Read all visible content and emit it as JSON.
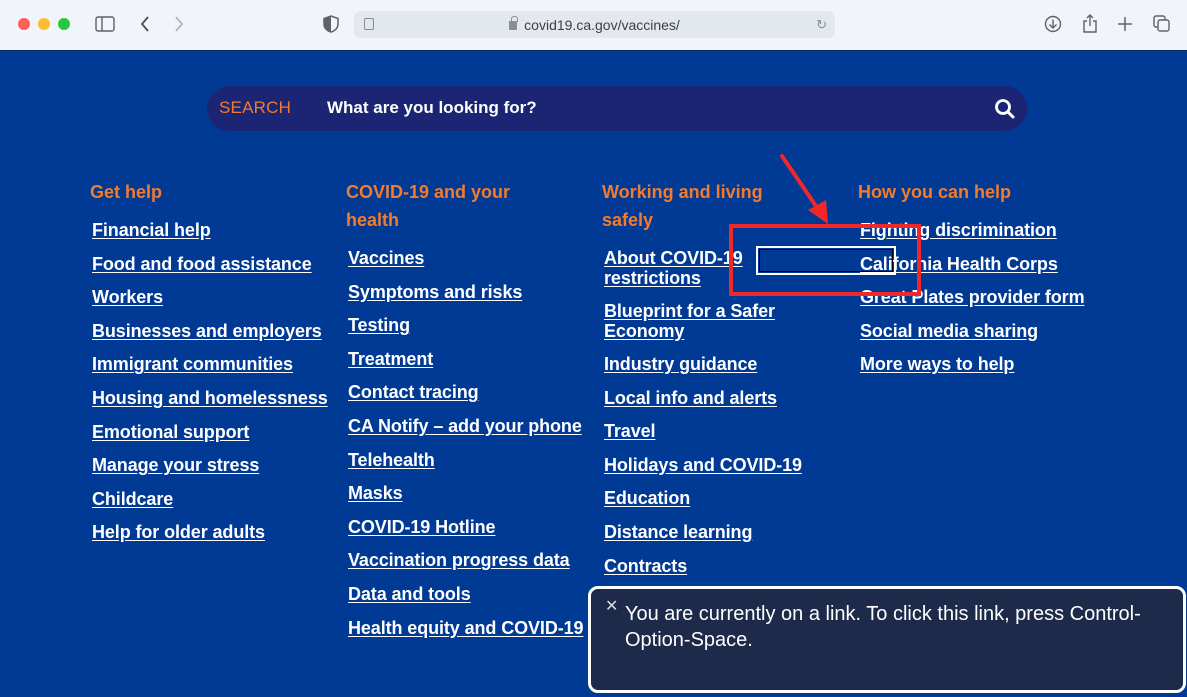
{
  "browser": {
    "url": "covid19.ca.gov/vaccines/",
    "icons": [
      "sidebar-icon",
      "back-icon",
      "forward-icon",
      "privacy-shield-icon",
      "reader-icon",
      "lock-icon",
      "reload-icon",
      "download-icon",
      "share-icon",
      "new-tab-icon",
      "tabs-overview-icon"
    ]
  },
  "search": {
    "label": "SEARCH",
    "placeholder": "What are you looking for?"
  },
  "colors": {
    "page_bg": "#003a95",
    "search_bg": "#1c2573",
    "heading": "#f47b2a",
    "annotation": "#f0282a"
  },
  "columns": [
    {
      "heading": "Get help",
      "links": [
        "Financial help",
        "Food and food assistance",
        "Workers",
        "Businesses and employers",
        "Immigrant communities",
        "Housing and homelessness",
        "Emotional support",
        "Manage your stress",
        "Childcare",
        "Help for older adults"
      ]
    },
    {
      "heading": "COVID-19 and your health",
      "links": [
        "Vaccines",
        "Symptoms and risks",
        "Testing",
        "Treatment",
        "Contact tracing",
        "CA Notify – add your phone",
        "Telehealth",
        "Masks",
        "COVID-19 Hotline",
        "Vaccination progress data",
        "Data and tools",
        "Health equity and COVID-19"
      ]
    },
    {
      "heading": "Working and living safely",
      "links": [
        "About COVID-19 restrictions",
        "Blueprint for a Safer Economy",
        "Industry guidance",
        "Local info and alerts",
        "Travel",
        "Holidays and COVID-19",
        "Education",
        "Distance learning",
        "Contracts"
      ]
    },
    {
      "heading": "How you can help",
      "links": [
        "Fighting discrimination",
        "California Health Corps",
        "Great Plates provider form",
        "Social media sharing",
        "More ways to help"
      ]
    }
  ],
  "voiceover": {
    "message": "You are currently on a link. To click this link, press Control-Option-Space."
  }
}
